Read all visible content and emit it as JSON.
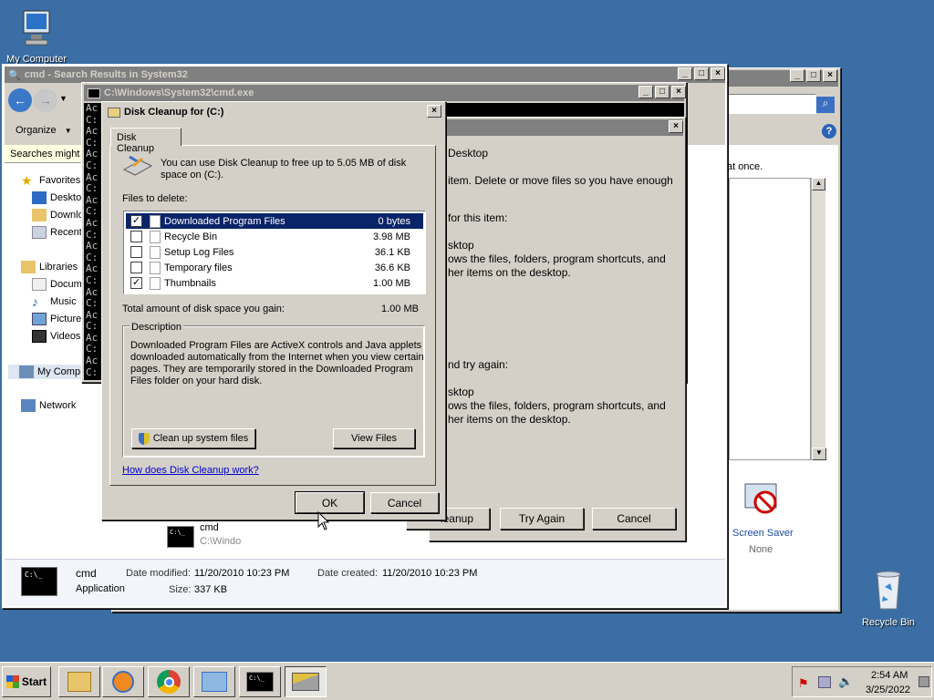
{
  "desktop": {
    "my_computer_label": "My Computer",
    "recycle_bin_label": "Recycle Bin"
  },
  "explorer": {
    "title": "cmd - Search Results in System32",
    "organize_label": "Organize",
    "info_bar": "Searches might b",
    "nav": {
      "favorites": "Favorites",
      "desktop": "Deskto",
      "downloads": "Downlo",
      "recent": "Recent",
      "libraries": "Libraries",
      "documents": "Docume",
      "music": "Music",
      "pictures": "Picture",
      "videos": "Videos",
      "my_computer": "My Comp",
      "network": "Network"
    },
    "result_name": "cmd",
    "result_path": "C:\\Windo",
    "details": {
      "name": "cmd",
      "type": "Application",
      "date_modified_label": "Date modified:",
      "date_modified": "11/20/2010 10:23 PM",
      "date_created_label": "Date created:",
      "date_created": "11/20/2010 10:23 PM",
      "size_label": "Size:",
      "size": "337 KB"
    }
  },
  "cmd_window": {
    "title": "C:\\Windows\\System32\\cmd.exe",
    "line_chars": [
      "Ac",
      "C:",
      "Ac",
      "C:",
      "Ac",
      "C:",
      "Ac",
      "C:",
      "Ac",
      "C:",
      "Ac",
      "C:",
      "Ac",
      "C:",
      "Ac",
      "C:",
      "Ac",
      "C:",
      "Ac",
      "C:",
      "Ac",
      "C:",
      "Ac",
      "C:"
    ]
  },
  "error_dialog": {
    "header": "Desktop",
    "line1": "item. Delete or move files so you have enough",
    "line2": "for this item:",
    "line3": "sktop",
    "line4": "ows the files, folders, program shortcuts, and",
    "line5": "her items on the desktop.",
    "line6": "nd try again:",
    "line7": "sktop",
    "line8": "ows the files, folders, program shortcuts, and",
    "line9": "her items on the desktop.",
    "cleanup_label": "leanup",
    "try_again_label": "Try Again",
    "cancel_label": "Cancel"
  },
  "right_window": {
    "info_text": "at once.",
    "screen_saver_label": "Screen Saver",
    "screen_saver_value": "None"
  },
  "disk_cleanup": {
    "title": "Disk Cleanup for  (C:)",
    "tab_label": "Disk Cleanup",
    "intro_line1": "You can use Disk Cleanup to free up to 5.05 MB of disk",
    "intro_line2": "space on  (C:).",
    "files_to_delete_label": "Files to delete:",
    "files": [
      {
        "name": "Downloaded Program Files",
        "size": "0 bytes",
        "checked": true,
        "selected": true
      },
      {
        "name": "Recycle Bin",
        "size": "3.98 MB",
        "checked": false,
        "selected": false
      },
      {
        "name": "Setup Log Files",
        "size": "36.1 KB",
        "checked": false,
        "selected": false
      },
      {
        "name": "Temporary files",
        "size": "36.6 KB",
        "checked": false,
        "selected": false
      },
      {
        "name": "Thumbnails",
        "size": "1.00 MB",
        "checked": true,
        "selected": false
      }
    ],
    "total_label": "Total amount of disk space you gain:",
    "total_value": "1.00 MB",
    "description_label": "Description",
    "description_lines": [
      "Downloaded Program Files are ActiveX controls and Java applets",
      "downloaded automatically from the Internet when you view certain",
      "pages. They are temporarily stored in the Downloaded Program",
      "Files folder on your hard disk."
    ],
    "clean_system_label": "Clean up system files",
    "view_files_label": "View Files",
    "help_link": "How does Disk Cleanup work?",
    "ok_label": "OK",
    "cancel_label": "Cancel"
  },
  "taskbar": {
    "start_label": "Start",
    "clock_time": "2:54 AM",
    "clock_date": "3/25/2022"
  }
}
